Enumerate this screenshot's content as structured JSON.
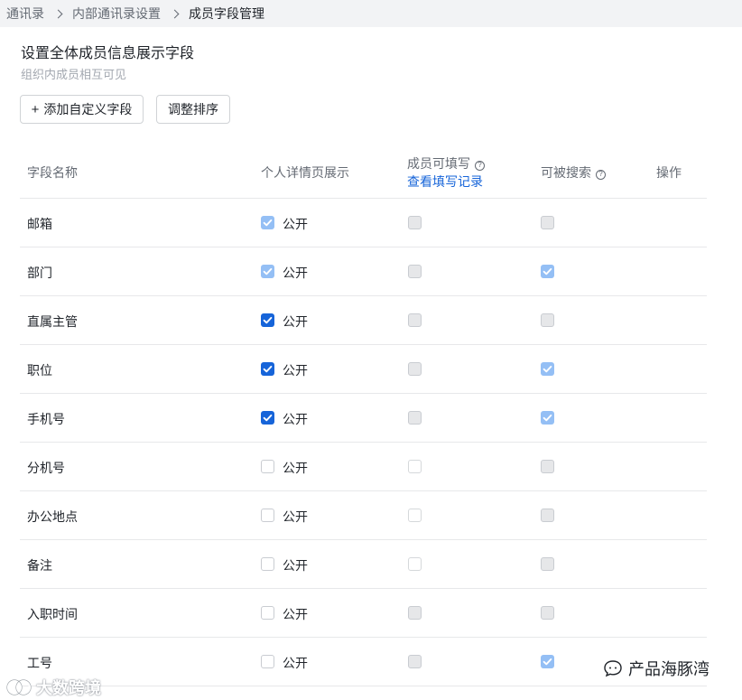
{
  "breadcrumb": [
    "通讯录",
    "内部通讯录设置",
    "成员字段管理"
  ],
  "page": {
    "title": "设置全体成员信息展示字段",
    "subtitle": "组织内成员相互可见"
  },
  "toolbar": {
    "add_label": "添加自定义字段",
    "add_icon": "+",
    "sort_label": "调整排序"
  },
  "table": {
    "headers": {
      "name": "字段名称",
      "public": "个人详情页展示",
      "fillable": "成员可填写",
      "fillable_link": "查看填写记录",
      "searchable": "可被搜索",
      "actions": "操作",
      "help_icon": "?"
    },
    "public_label": "公开",
    "rows": [
      {
        "name": "邮箱",
        "public": "checked-disabled",
        "fill": "disabled-gray",
        "search": "disabled-gray"
      },
      {
        "name": "部门",
        "public": "checked-disabled",
        "fill": "disabled-gray",
        "search": "checked-disabled"
      },
      {
        "name": "直属主管",
        "public": "checked",
        "fill": "disabled-gray",
        "search": "disabled-gray"
      },
      {
        "name": "职位",
        "public": "checked",
        "fill": "disabled-gray",
        "search": "checked-disabled"
      },
      {
        "name": "手机号",
        "public": "checked",
        "fill": "disabled-gray",
        "search": "checked-disabled"
      },
      {
        "name": "分机号",
        "public": "unchecked",
        "fill": "disabled-white",
        "search": "disabled-gray"
      },
      {
        "name": "办公地点",
        "public": "unchecked",
        "fill": "disabled-white",
        "search": "disabled-gray"
      },
      {
        "name": "备注",
        "public": "unchecked",
        "fill": "disabled-white",
        "search": "disabled-gray"
      },
      {
        "name": "入职时间",
        "public": "unchecked",
        "fill": "disabled-gray",
        "search": "disabled-gray"
      },
      {
        "name": "工号",
        "public": "unchecked",
        "fill": "disabled-gray",
        "search": "checked-disabled"
      }
    ]
  },
  "watermarks": {
    "right": "产品海豚湾",
    "left": "大数跨境"
  },
  "colors": {
    "accent": "#1664d9",
    "accent_disabled": "#94bff5",
    "breadcrumb_bg": "#f2f3f5"
  }
}
